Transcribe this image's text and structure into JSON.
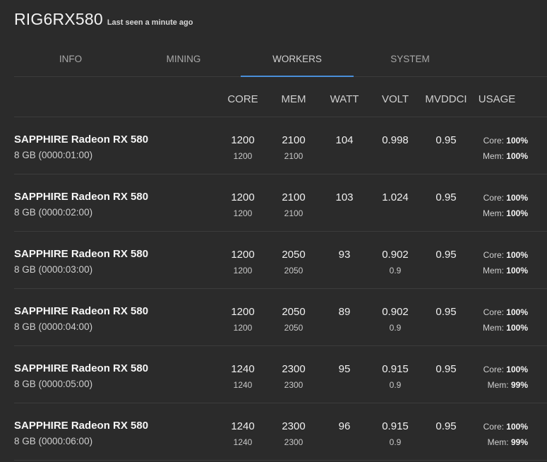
{
  "header": {
    "title": "RIG6RX580",
    "status": "Last seen a minute ago"
  },
  "tabs": [
    {
      "label": "INFO"
    },
    {
      "label": "MINING"
    },
    {
      "label": "WORKERS"
    },
    {
      "label": "SYSTEM"
    }
  ],
  "active_tab": "WORKERS",
  "columns": [
    "CORE",
    "MEM",
    "WATT",
    "VOLT",
    "MVDDCI",
    "USAGE"
  ],
  "usage_labels": {
    "core": "Core:",
    "mem": "Mem:"
  },
  "accent_color": "#4a8fd9",
  "gpus": [
    {
      "name": "SAPPHIRE Radeon RX 580",
      "sub": "8 GB (0000:01:00)",
      "core": "1200",
      "core_sub": "1200",
      "mem": "2100",
      "mem_sub": "2100",
      "watt": "104",
      "volt": "0.998",
      "volt_sub": "",
      "mvddci": "0.95",
      "usage_core": "100%",
      "usage_mem": "100%"
    },
    {
      "name": "SAPPHIRE Radeon RX 580",
      "sub": "8 GB (0000:02:00)",
      "core": "1200",
      "core_sub": "1200",
      "mem": "2100",
      "mem_sub": "2100",
      "watt": "103",
      "volt": "1.024",
      "volt_sub": "",
      "mvddci": "0.95",
      "usage_core": "100%",
      "usage_mem": "100%"
    },
    {
      "name": "SAPPHIRE Radeon RX 580",
      "sub": "8 GB (0000:03:00)",
      "core": "1200",
      "core_sub": "1200",
      "mem": "2050",
      "mem_sub": "2050",
      "watt": "93",
      "volt": "0.902",
      "volt_sub": "0.9",
      "mvddci": "0.95",
      "usage_core": "100%",
      "usage_mem": "100%"
    },
    {
      "name": "SAPPHIRE Radeon RX 580",
      "sub": "8 GB (0000:04:00)",
      "core": "1200",
      "core_sub": "1200",
      "mem": "2050",
      "mem_sub": "2050",
      "watt": "89",
      "volt": "0.902",
      "volt_sub": "0.9",
      "mvddci": "0.95",
      "usage_core": "100%",
      "usage_mem": "100%"
    },
    {
      "name": "SAPPHIRE Radeon RX 580",
      "sub": "8 GB (0000:05:00)",
      "core": "1240",
      "core_sub": "1240",
      "mem": "2300",
      "mem_sub": "2300",
      "watt": "95",
      "volt": "0.915",
      "volt_sub": "0.9",
      "mvddci": "0.95",
      "usage_core": "100%",
      "usage_mem": "99%"
    },
    {
      "name": "SAPPHIRE Radeon RX 580",
      "sub": "8 GB (0000:06:00)",
      "core": "1240",
      "core_sub": "1240",
      "mem": "2300",
      "mem_sub": "2300",
      "watt": "96",
      "volt": "0.915",
      "volt_sub": "0.9",
      "mvddci": "0.95",
      "usage_core": "100%",
      "usage_mem": "99%"
    }
  ]
}
